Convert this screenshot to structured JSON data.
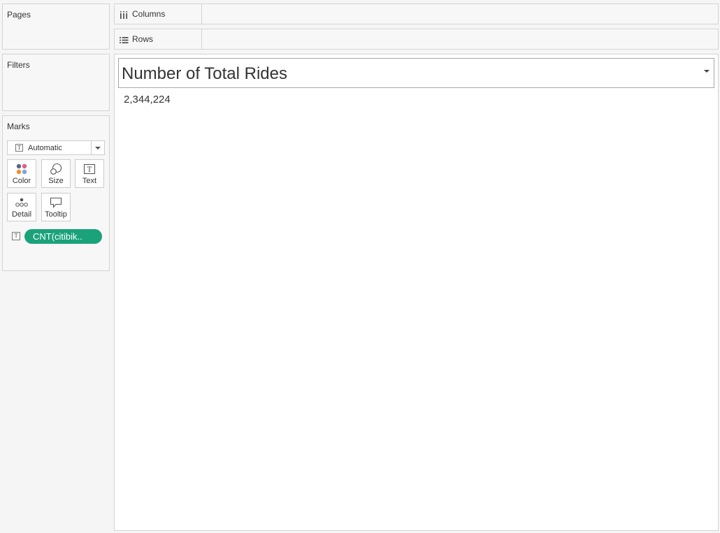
{
  "pages": {
    "title": "Pages"
  },
  "filters": {
    "title": "Filters"
  },
  "marks": {
    "title": "Marks",
    "mark_type": {
      "icon": "text-icon",
      "label": "Automatic"
    },
    "buttons": [
      {
        "id": "color",
        "label": "Color",
        "icon": "color-dots-icon"
      },
      {
        "id": "size",
        "label": "Size",
        "icon": "size-circles-icon"
      },
      {
        "id": "text",
        "label": "Text",
        "icon": "text-box-icon"
      },
      {
        "id": "detail",
        "label": "Detail",
        "icon": "detail-dots-icon"
      },
      {
        "id": "tooltip",
        "label": "Tooltip",
        "icon": "speech-bubble-icon"
      }
    ],
    "pill": {
      "label": "CNT(citibik..",
      "color": "#1aa27a"
    }
  },
  "shelves": {
    "columns": {
      "label": "Columns",
      "icon": "columns-icon"
    },
    "rows": {
      "label": "Rows",
      "icon": "rows-icon"
    }
  },
  "view": {
    "title": "Number of Total Rides",
    "value": "2,344,224"
  }
}
